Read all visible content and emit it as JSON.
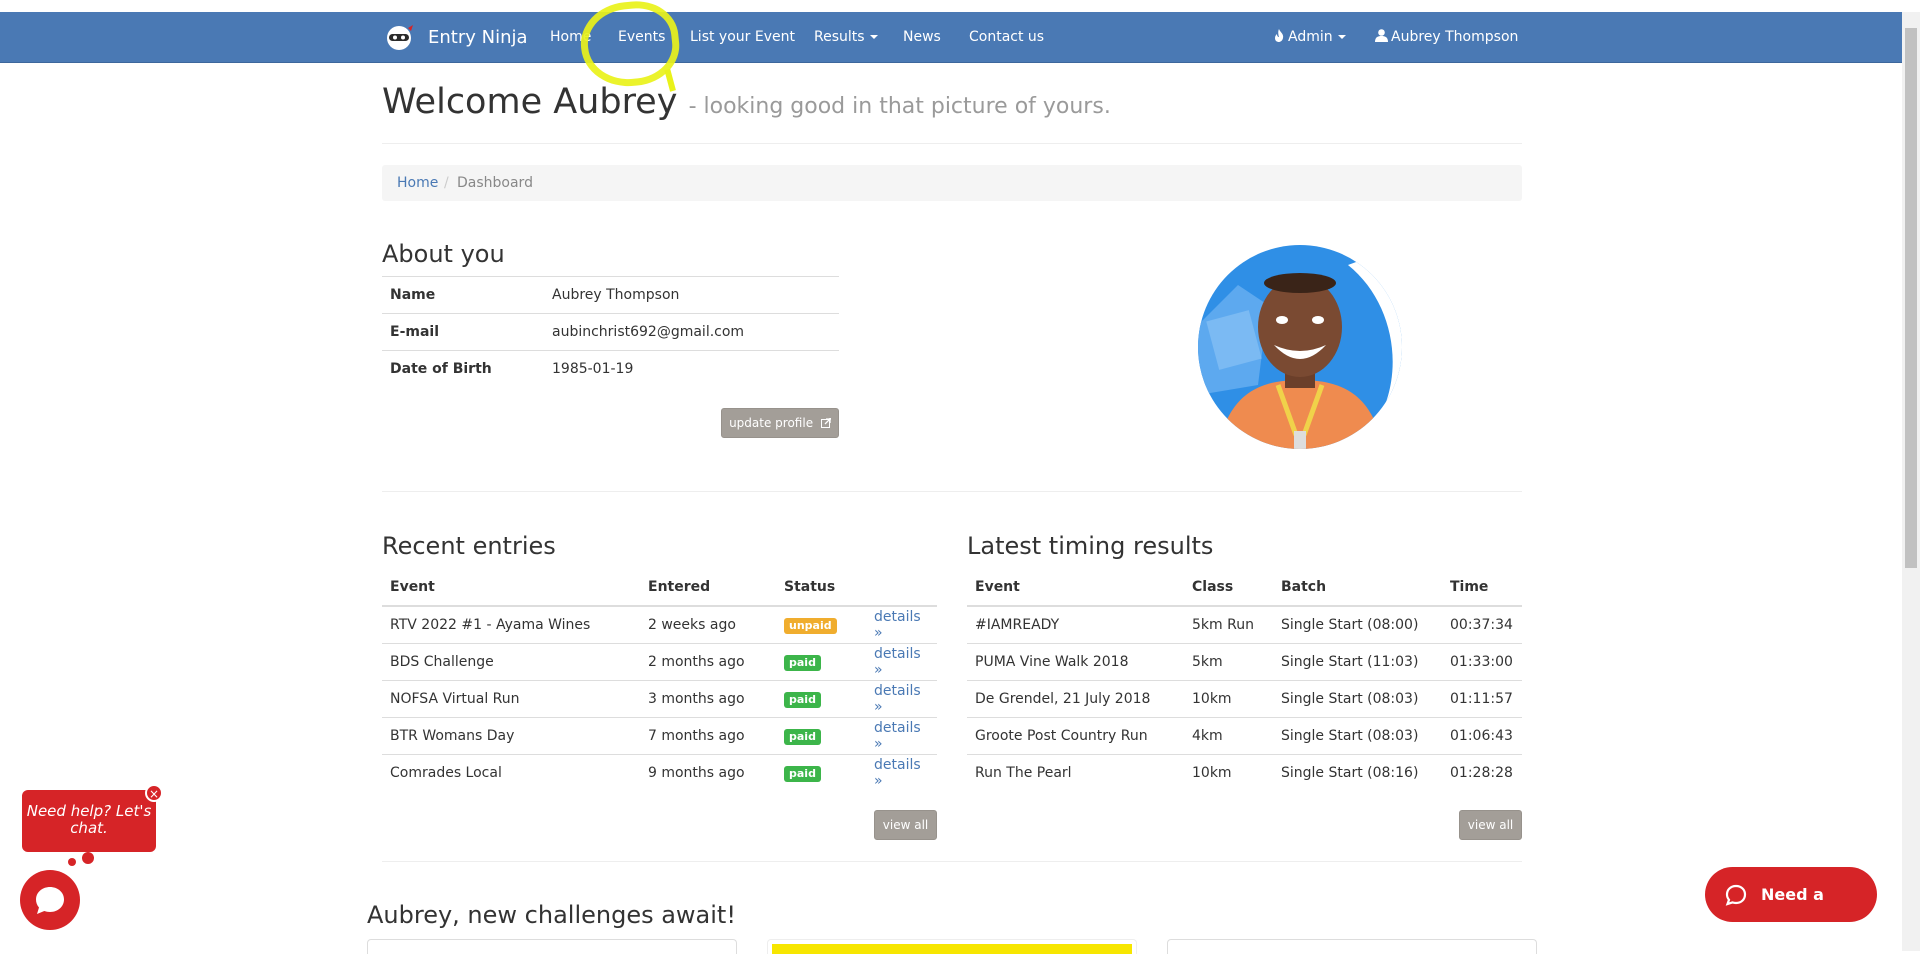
{
  "nav": {
    "brand": "Entry Ninja",
    "items": [
      "Home",
      "Events",
      "List your Event",
      "Results",
      "News",
      "Contact us"
    ],
    "admin": "Admin",
    "user": "Aubrey Thompson"
  },
  "header": {
    "title": "Welcome Aubrey",
    "subtitle": "- looking good in that picture of yours."
  },
  "breadcrumb": {
    "home": "Home",
    "separator": "/",
    "current": "Dashboard"
  },
  "about": {
    "heading": "About you",
    "rows": [
      {
        "label": "Name",
        "value": "Aubrey Thompson"
      },
      {
        "label": "E-mail",
        "value": "aubinchrist692@gmail.com"
      },
      {
        "label": "Date of Birth",
        "value": "1985-01-19"
      }
    ],
    "update_button": "update profile"
  },
  "recent_entries": {
    "heading": "Recent entries",
    "columns": [
      "Event",
      "Entered",
      "Status"
    ],
    "rows": [
      {
        "event": "RTV 2022 #1 - Ayama Wines",
        "entered": "2 weeks ago",
        "status": "unpaid",
        "link": "details »"
      },
      {
        "event": "BDS Challenge",
        "entered": "2 months ago",
        "status": "paid",
        "link": "details »"
      },
      {
        "event": "NOFSA Virtual Run",
        "entered": "3 months ago",
        "status": "paid",
        "link": "details »"
      },
      {
        "event": "BTR Womans Day",
        "entered": "7 months ago",
        "status": "paid",
        "link": "details »"
      },
      {
        "event": "Comrades Local",
        "entered": "9 months ago",
        "status": "paid",
        "link": "details »"
      }
    ],
    "view_all": "view all"
  },
  "latest_results": {
    "heading": "Latest timing results",
    "columns": [
      "Event",
      "Class",
      "Batch",
      "Time"
    ],
    "rows": [
      {
        "event": "#IAMREADY",
        "class": "5km Run",
        "batch": "Single Start (08:00)",
        "time": "00:37:34"
      },
      {
        "event": "PUMA Vine Walk 2018",
        "class": "5km",
        "batch": "Single Start (11:03)",
        "time": "01:33:00"
      },
      {
        "event": "De Grendel, 21 July 2018",
        "class": "10km",
        "batch": "Single Start (08:03)",
        "time": "01:11:57"
      },
      {
        "event": "Groote Post Country Run",
        "class": "4km",
        "batch": "Single Start (08:03)",
        "time": "01:06:43"
      },
      {
        "event": "Run The Pearl",
        "class": "10km",
        "batch": "Single Start (08:16)",
        "time": "01:28:28"
      }
    ],
    "view_all": "view all"
  },
  "challenges": {
    "heading": "Aubrey, new challenges await!"
  },
  "chat": {
    "bubble": "Need help? Let's chat.",
    "close": "×",
    "need_hand": "Need a hand?"
  },
  "colors": {
    "navbar": "#4a79b4",
    "paid": "#3cb54a",
    "unpaid": "#f0ad2e",
    "chat": "#d62427",
    "highlight": "#e9f21a"
  }
}
